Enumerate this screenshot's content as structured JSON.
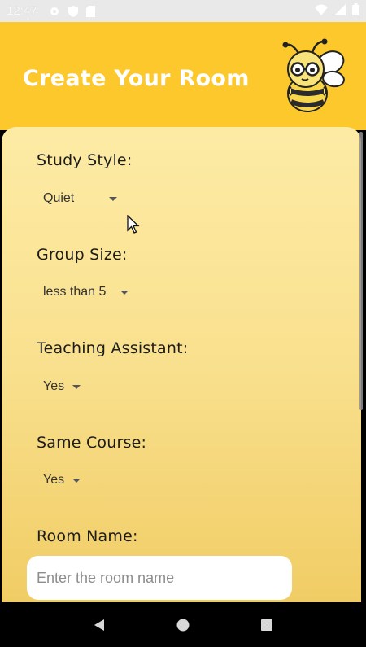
{
  "status_bar": {
    "time": "12:47",
    "icons_left": [
      "gear-icon",
      "shield-icon",
      "sim-card-icon"
    ],
    "icons_right": [
      "wifi-icon",
      "signal-icon",
      "battery-icon"
    ]
  },
  "header": {
    "title": "Create Your Room",
    "background": "#fcc82b",
    "mascot": "bee-mascot-icon"
  },
  "form": {
    "study_style": {
      "label": "Study Style:",
      "value": "Quiet"
    },
    "group_size": {
      "label": "Group Size:",
      "value": "less than 5"
    },
    "teaching_assistant": {
      "label": "Teaching Assistant:",
      "value": "Yes"
    },
    "same_course": {
      "label": "Same Course:",
      "value": "Yes"
    },
    "room_name": {
      "label": "Room Name:",
      "placeholder": "Enter the room name",
      "value": ""
    }
  },
  "nav_bar": {
    "buttons": [
      "back-icon",
      "home-icon",
      "recents-icon"
    ]
  }
}
